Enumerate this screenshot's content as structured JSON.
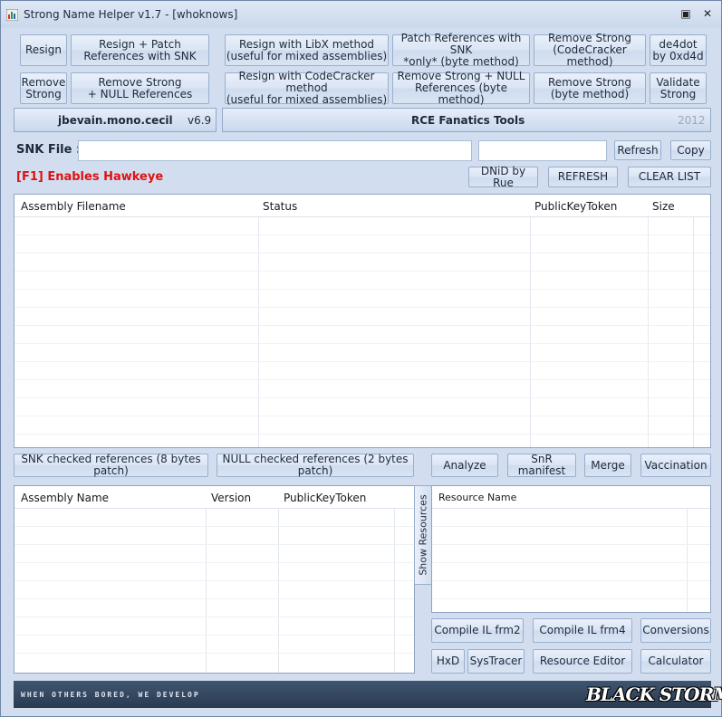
{
  "window": {
    "title": "Strong Name Helper v1.7 - [whoknows]",
    "restore_glyph": "▣",
    "close_glyph": "✕"
  },
  "toolbar": {
    "resign": "Resign",
    "resign_patch": "Resign + Patch\nReferences with SNK",
    "resign_libx": "Resign with LibX method\n(useful for mixed assemblies)",
    "patch_refs_snk": "Patch References with SNK\n*only*  (byte method)",
    "remove_strong_cc": "Remove Strong\n(CodeCracker method)",
    "de4dot": "de4dot\nby 0xd4d",
    "remove_strong": "Remove\nStrong",
    "remove_strong_null": "Remove Strong\n+ NULL References",
    "resign_cc": "Resign with CodeCracker method\n(useful for mixed assemblies)",
    "remove_strong_null_byte": "Remove Strong + NULL\nReferences (byte method)",
    "remove_strong_byte": "Remove Strong\n(byte method)",
    "validate_strong": "Validate\nStrong"
  },
  "info_bar": {
    "lib_name": "jbevain.mono.cecil",
    "lib_version": "v6.9",
    "team_name": "RCE Fanatics Tools",
    "year": "2012"
  },
  "snk": {
    "label": "SNK File :",
    "path_value": "",
    "extra_value": "",
    "refresh": "Refresh",
    "copy": "Copy"
  },
  "hawkeye": "[F1] Enables Hawkeye",
  "actions": {
    "dnid": "DNiD by Rue",
    "refresh": "REFRESH",
    "clear_list": "CLEAR LIST"
  },
  "assemblies_table": {
    "columns": [
      "Assembly Filename",
      "Status",
      "PublicKeyToken",
      "Size"
    ]
  },
  "patch_buttons": {
    "snk_checked": "SNK checked references (8 bytes patch)",
    "null_checked": "NULL checked references (2 bytes patch)"
  },
  "tool_buttons": {
    "analyze": "Analyze",
    "snr_manifest": "SnR manifest",
    "merge": "Merge",
    "vaccination": "Vaccination"
  },
  "references_table": {
    "columns": [
      "Assembly Name",
      "Version",
      "PublicKeyToken"
    ]
  },
  "show_resources": "Show Resources",
  "resources_table": {
    "columns": [
      "Resource Name"
    ]
  },
  "bottom_buttons": {
    "compile_frm2": "Compile IL frm2",
    "compile_frm4": "Compile IL frm4",
    "conversions": "Conversions",
    "hxd": "HxD",
    "systracer": "SysTracer",
    "resource_editor": "Resource Editor",
    "calculator": "Calculator"
  },
  "footer": {
    "slogan": "WHEN OTHERS BORED, WE DEVELOP",
    "logo": "BLACK STORM"
  }
}
